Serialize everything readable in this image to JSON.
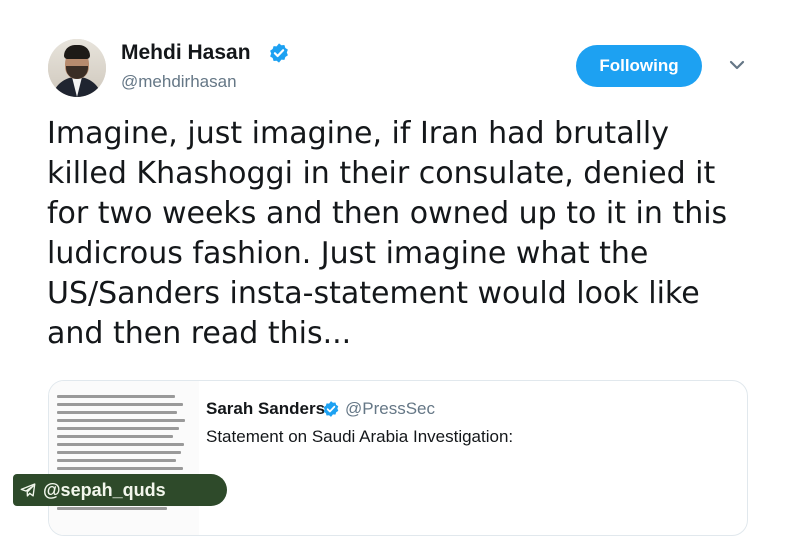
{
  "tweet": {
    "author": {
      "name": "Mehdi Hasan",
      "handle": "@mehdirhasan",
      "verified": true,
      "avatar_icon": "profile-photo"
    },
    "follow_button_label": "Following",
    "menu_icon": "chevron-down-icon",
    "text_lines": [
      "Imagine, just imagine, if Iran had brutally",
      "killed Khashoggi in their consulate, denied it",
      "for two weeks and then owned up to it in this",
      "ludicrous fashion. Just imagine what the",
      "US/Sanders insta-statement would look like",
      "and then read this..."
    ]
  },
  "quoted_tweet": {
    "name": "Sarah Sanders",
    "handle": "@PressSec",
    "verified": true,
    "text": "Statement on Saudi Arabia Investigation:",
    "thumbnail_icon": "statement-document-image"
  },
  "watermark": {
    "text": "@sepah_quds",
    "icon": "telegram-plane-icon"
  },
  "colors": {
    "accent": "#1da1f2",
    "text_primary": "#14171a",
    "text_secondary": "#657786",
    "border": "#e1e8ed",
    "watermark_bg": "#2e4a2a"
  }
}
